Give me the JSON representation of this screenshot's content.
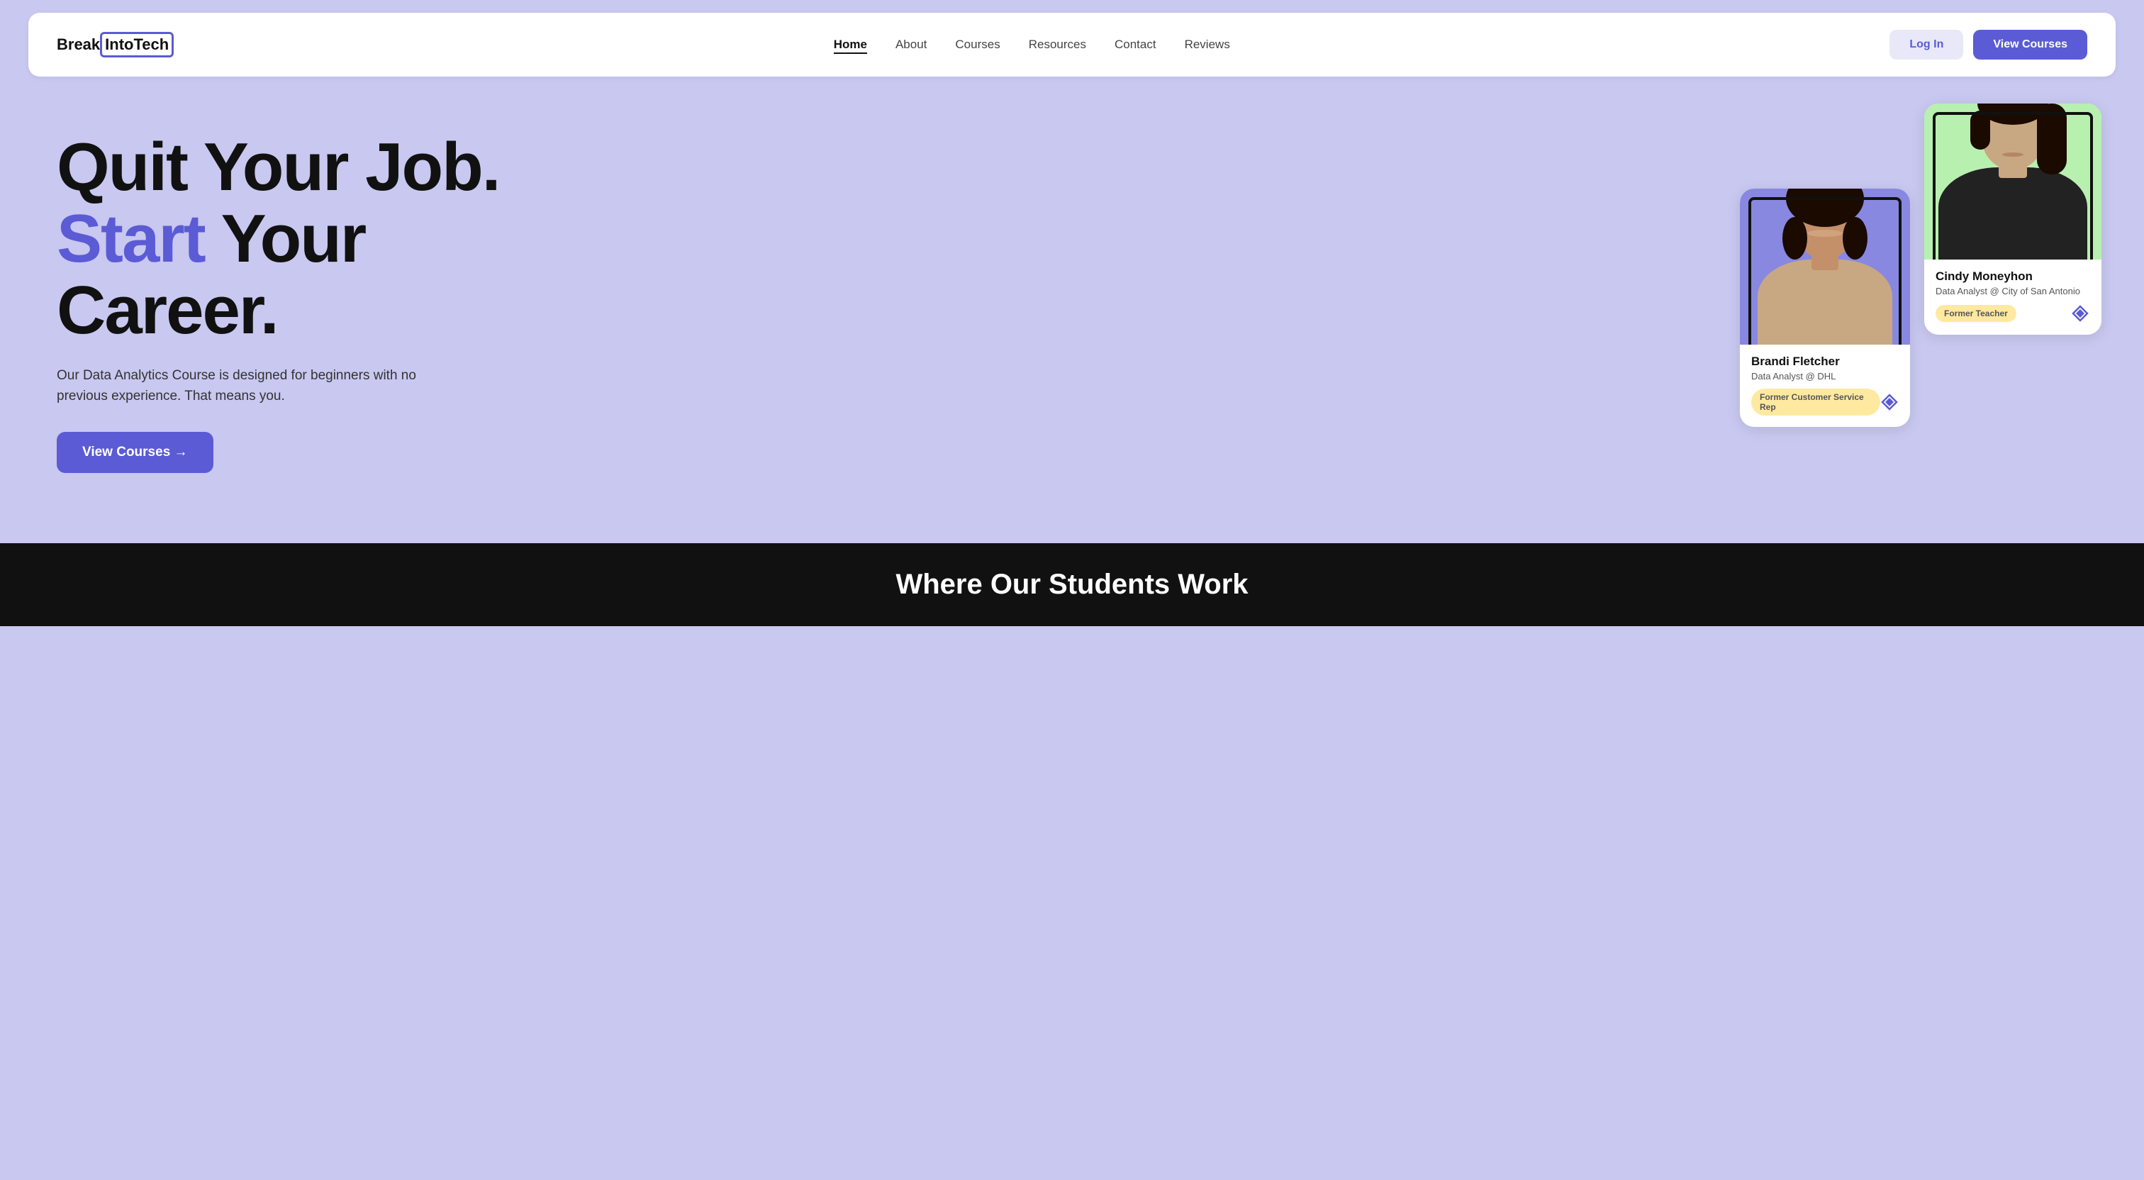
{
  "nav": {
    "logo_text_before": "Break ",
    "logo_text_highlight": "IntoTech",
    "links": [
      {
        "label": "Home",
        "active": true
      },
      {
        "label": "About",
        "active": false
      },
      {
        "label": "Courses",
        "active": false
      },
      {
        "label": "Resources",
        "active": false
      },
      {
        "label": "Contact",
        "active": false
      },
      {
        "label": "Reviews",
        "active": false
      }
    ],
    "login_label": "Log In",
    "view_courses_label": "View Courses"
  },
  "hero": {
    "headline_line1": "Quit Your Job.",
    "headline_start": "Start",
    "headline_line2": " Your",
    "headline_line3": "Career.",
    "subtext": "Our Data Analytics Course is designed for beginners with no previous experience. That means you.",
    "cta_label": "View Courses →"
  },
  "cards": [
    {
      "name": "Brandi Fletcher",
      "role": "Data Analyst @  DHL",
      "tag": "Former Customer Service Rep",
      "bg": "purple"
    },
    {
      "name": "Cindy Moneyhon",
      "role": "Data Analyst @ City of San Antonio",
      "tag": "Former Teacher",
      "bg": "green"
    }
  ],
  "bottom_banner": {
    "heading": "Where Our Students Work"
  }
}
